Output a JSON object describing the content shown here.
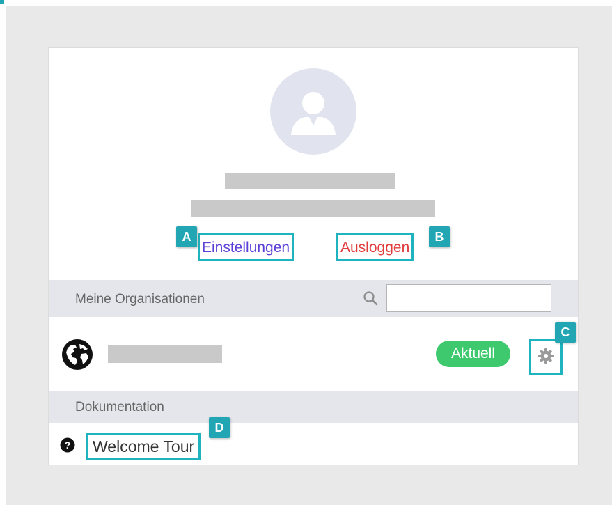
{
  "profile": {
    "avatar_icon": "user-avatar-icon",
    "settings_link": "Einstellungen",
    "logout_link": "Ausloggen"
  },
  "organisations": {
    "section_label": "Meine Organisationen",
    "search_icon": "search-icon",
    "search_value": "",
    "items": [
      {
        "icon": "globe-icon",
        "status": "Aktuell",
        "settings_icon": "gear-icon"
      }
    ]
  },
  "documentation": {
    "section_label": "Dokumentation",
    "items": [
      {
        "icon": "question-circle-icon",
        "label": "Welcome Tour"
      }
    ]
  },
  "annotations": {
    "a": "A",
    "b": "B",
    "c": "C",
    "d": "D"
  },
  "colors": {
    "accent": "#22a6b3",
    "settings_link": "#5b3fd6",
    "logout_link": "#e23b3b",
    "status_green": "#3ec96e"
  }
}
